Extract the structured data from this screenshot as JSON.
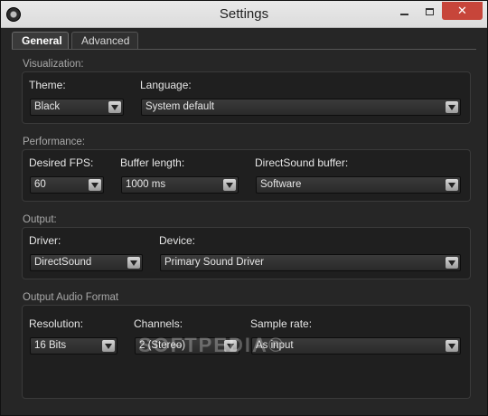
{
  "window": {
    "title": "Settings",
    "close_glyph": "✕"
  },
  "tabs": [
    {
      "label": "General",
      "active": true
    },
    {
      "label": "Advanced",
      "active": false
    }
  ],
  "visualization": {
    "section": "Visualization:",
    "theme_label": "Theme:",
    "theme_value": "Black",
    "language_label": "Language:",
    "language_value": "System default"
  },
  "performance": {
    "section": "Performance:",
    "fps_label": "Desired FPS:",
    "fps_value": "60",
    "buffer_label": "Buffer length:",
    "buffer_value": "1000 ms",
    "dsbuffer_label": "DirectSound buffer:",
    "dsbuffer_value": "Software"
  },
  "output": {
    "section": "Output:",
    "driver_label": "Driver:",
    "driver_value": "DirectSound",
    "device_label": "Device:",
    "device_value": "Primary Sound Driver"
  },
  "audio_format": {
    "section": "Output Audio Format",
    "resolution_label": "Resolution:",
    "resolution_value": "16 Bits",
    "channels_label": "Channels:",
    "channels_value": "2 (Stereo)",
    "samplerate_label": "Sample rate:",
    "samplerate_value": "As input"
  },
  "watermark": "SOFTPEDIA®",
  "icons": [
    "app-icon",
    "minimize-icon",
    "maximize-icon",
    "close-icon",
    "dropdown-arrow-icon"
  ],
  "colors": {
    "background": "#262626",
    "group_bg": "#1f1f1f",
    "close_button": "#c7453a",
    "text": "#e6e6e6",
    "section_text": "#a8a8a8"
  }
}
